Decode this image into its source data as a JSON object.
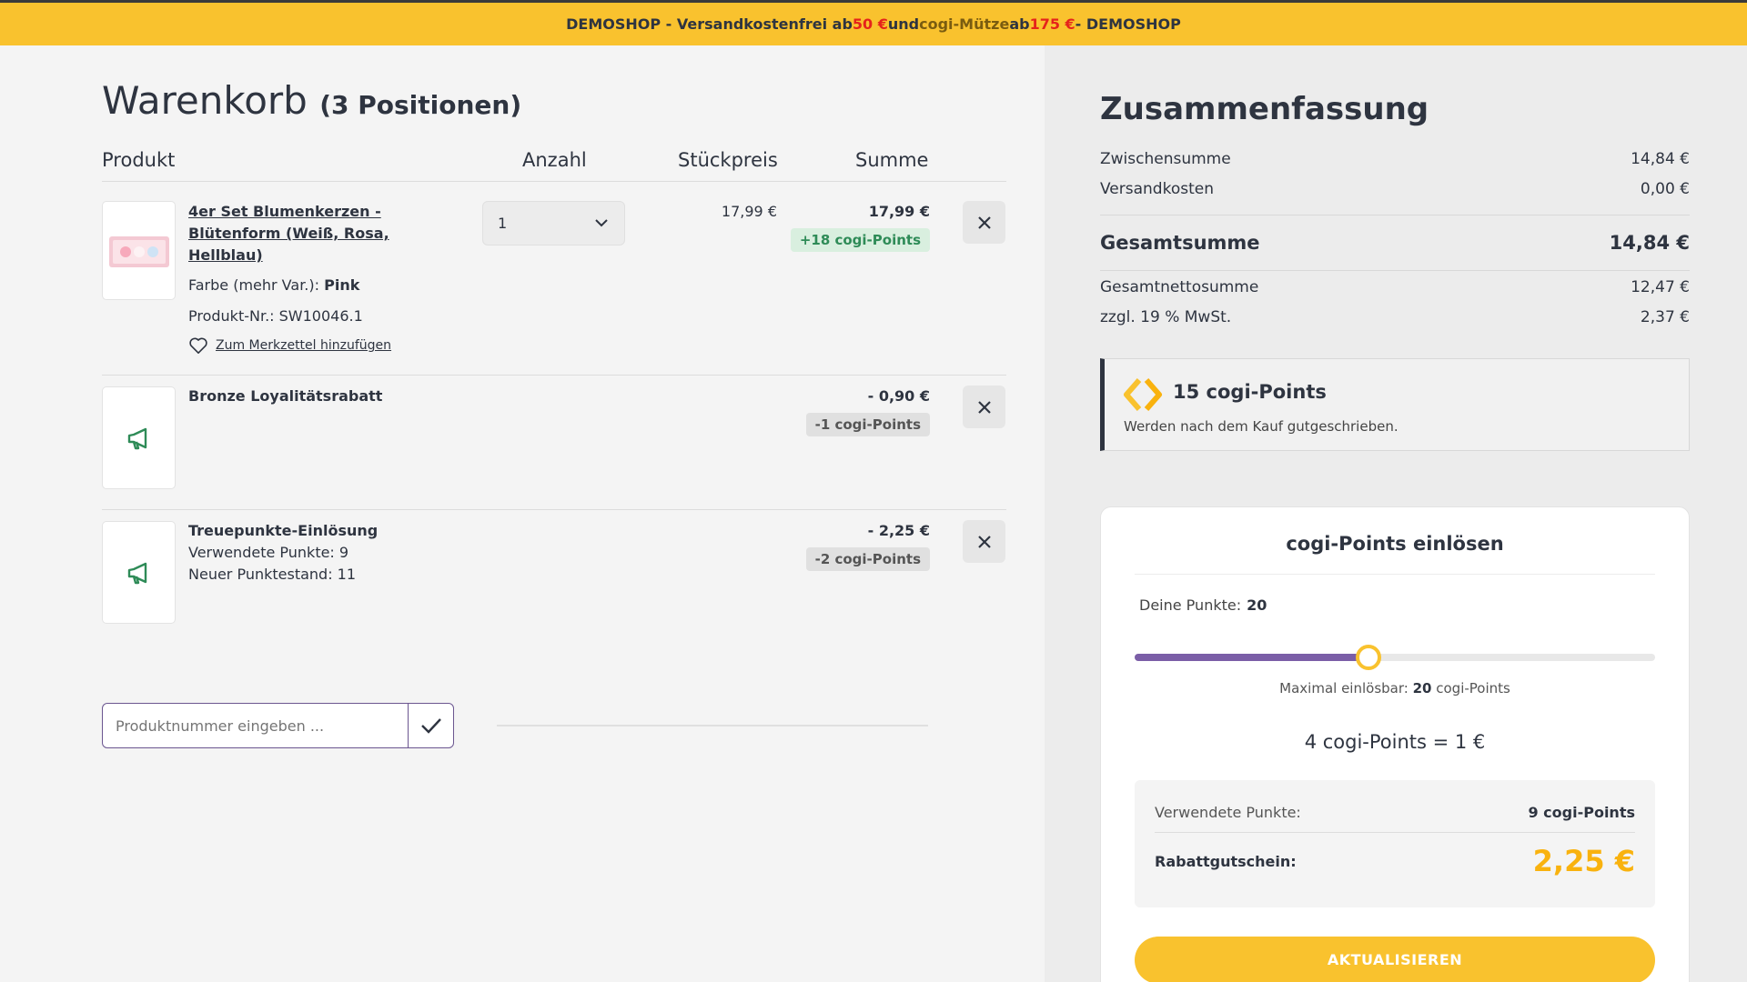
{
  "promo": {
    "part1": "DEMOSHOP - Versandkostenfrei ab ",
    "amount1": "50 €",
    "part2": " und ",
    "brand": "cogi-Mütze",
    "part3": " ab ",
    "amount2": "175 €",
    "part4": " - DEMOSHOP"
  },
  "cart": {
    "title": "Warenkorb",
    "count": "(3 Positionen)",
    "headers": {
      "product": "Produkt",
      "qty": "Anzahl",
      "unit": "Stückpreis",
      "sum": "Summe"
    },
    "items": [
      {
        "title": "4er Set Blumenkerzen - Blütenform (Weiß, Rosa, Hellblau)",
        "color_label": "Farbe (mehr Var.): ",
        "color_value": "Pink",
        "sku": "Produkt-Nr.: SW10046.1",
        "wishlist": "Zum Merkzettel hinzufügen",
        "qty": "1",
        "unit_price": "17,99 €",
        "sum": "17,99 €",
        "points": "+18 cogi-Points"
      },
      {
        "title": "Bronze Loyalitätsrabatt",
        "sum": "- 0,90 €",
        "points": "-1 cogi-Points"
      },
      {
        "title": "Treuepunkte-Einlösung",
        "line1": "Verwendete Punkte: 9",
        "line2": "Neuer Punktestand: 11",
        "sum": "- 2,25 €",
        "points": "-2 cogi-Points"
      }
    ],
    "code_placeholder": "Produktnummer eingeben ..."
  },
  "summary": {
    "title": "Zusammenfassung",
    "subtotal_label": "Zwischensumme",
    "subtotal": "14,84 €",
    "shipping_label": "Versandkosten",
    "shipping": "0,00 €",
    "total_label": "Gesamtsumme",
    "total": "14,84 €",
    "net_label": "Gesamtnettosumme",
    "net": "12,47 €",
    "vat_label": "zzgl. 19 % MwSt.",
    "vat": "2,37 €"
  },
  "points_info": {
    "title": "15 cogi-Points",
    "subtitle": "Werden nach dem Kauf gutgeschrieben."
  },
  "redeem": {
    "title": "cogi-Points einlösen",
    "mine_label": "Deine Punkte:",
    "mine_value": "20",
    "slider_fraction": 0.45,
    "max_label": "Maximal einlösbar:",
    "max_value": "20",
    "max_unit": "cogi-Points",
    "rate": "4 cogi-Points = 1 €",
    "used_label": "Verwendete Punkte:",
    "used_value": "9 cogi-Points",
    "voucher_label": "Rabattgutschein:",
    "voucher_value": "2,25 €",
    "button": "AKTUALISIEREN"
  },
  "colors": {
    "accent": "#f9c22e",
    "purple": "#7b5ea7",
    "green": "#2e8b57",
    "red": "#e5231b"
  }
}
